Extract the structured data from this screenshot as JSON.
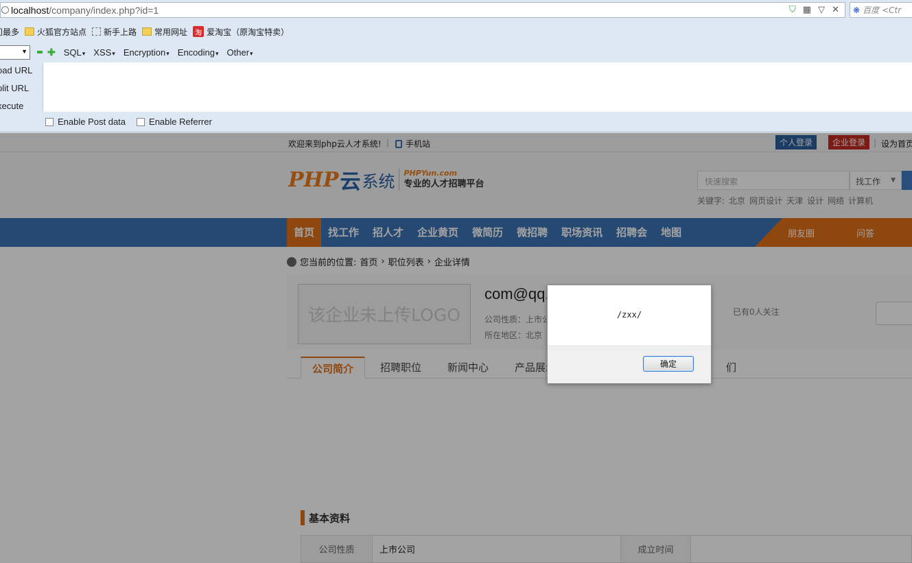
{
  "browser": {
    "url_host": "localhost",
    "url_path": "/company/index.php?id=1",
    "search_engine": "百度",
    "search_hint": "<Ctr"
  },
  "bookmarks": [
    {
      "label": "问最多",
      "icon": "none"
    },
    {
      "label": "火狐官方站点",
      "icon": "folder-icon"
    },
    {
      "label": "新手上路",
      "icon": "dashed-box-icon"
    },
    {
      "label": "常用网址",
      "icon": "folder-icon"
    },
    {
      "label": "爱淘宝（原淘宝特卖）",
      "icon": "taobao-icon"
    }
  ],
  "hackbar": {
    "menus": [
      "SQL",
      "XSS",
      "Encryption",
      "Encoding",
      "Other"
    ],
    "side": [
      "oad URL",
      "plit URL",
      "xecute"
    ],
    "options": [
      "Enable Post data",
      "Enable Referrer"
    ]
  },
  "topbar": {
    "welcome": "欢迎来到php云人才系统!",
    "mobile": "手机站",
    "personal_login": "个人登录",
    "company_login": "企业登录",
    "set_home": "设为首页"
  },
  "logo": {
    "php": "PHP",
    "yun": "云",
    "xitong": "系统",
    "domain": "PHPYun.com",
    "slogan": "专业的人才招聘平台"
  },
  "search": {
    "placeholder": "快速搜索",
    "type": "找工作",
    "keywords_label": "关键字:",
    "keywords": [
      "北京",
      "网页设计",
      "天津",
      "设计",
      "网络",
      "计算机"
    ]
  },
  "nav": {
    "items": [
      "首页",
      "找工作",
      "招人才",
      "企业黄页",
      "微简历",
      "微招聘",
      "职场资讯",
      "招聘会",
      "地图"
    ],
    "right": [
      "朋友圈",
      "问答"
    ]
  },
  "breadcrumb": {
    "prefix": "您当前的位置:",
    "items": [
      "首页",
      "职位列表",
      "企业详情"
    ]
  },
  "company": {
    "logo_placeholder": "该企业未上传LOGO",
    "name": "com@qq.",
    "type": "公司性质：上市公",
    "area": "所在地区：北京",
    "followers": "已有0人关注"
  },
  "tabs": [
    "公司简介",
    "招聘职位",
    "新闻中心",
    "产品展示",
    "们"
  ],
  "basic": {
    "title": "基本资料",
    "label1": "公司性质",
    "value1": "上市公司",
    "label2": "成立时间"
  },
  "dialog": {
    "message": "/zxx/",
    "ok": "确定"
  },
  "colors": {
    "orange": "#e0701a",
    "nav_blue": "#3a73b3",
    "personal_blue": "#2c5f9b",
    "company_red": "#c02b1e"
  }
}
